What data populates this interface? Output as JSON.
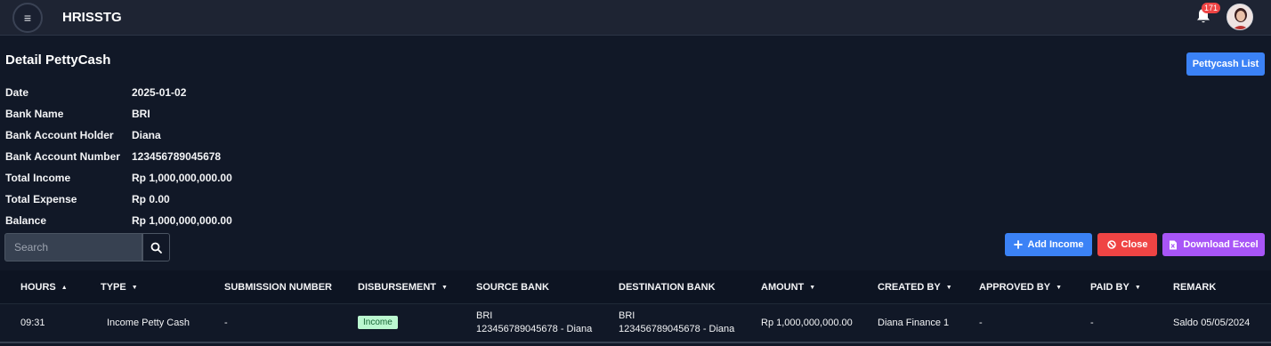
{
  "app": {
    "title": "HRISSTG",
    "menu_icon": "≡",
    "notification_count": "171"
  },
  "page": {
    "title": "Detail PettyCash",
    "list_button": "Pettycash List"
  },
  "info": [
    {
      "label": "Date",
      "value": "2025-01-02"
    },
    {
      "label": "Bank Name",
      "value": "BRI"
    },
    {
      "label": "Bank Account Holder",
      "value": "Diana"
    },
    {
      "label": "Bank Account Number",
      "value": "123456789045678"
    },
    {
      "label": "Total Income",
      "value": "Rp 1,000,000,000.00"
    },
    {
      "label": "Total Expense",
      "value": "Rp 0.00"
    },
    {
      "label": "Balance",
      "value": "Rp 1,000,000,000.00"
    }
  ],
  "search": {
    "placeholder": "Search"
  },
  "actions": {
    "add_income": "Add Income",
    "close": "Close",
    "download_excel": "Download Excel"
  },
  "table": {
    "headers": {
      "hours": "HOURS",
      "type": "TYPE",
      "submission_number": "SUBMISSION NUMBER",
      "disbursement": "DISBURSEMENT",
      "source_bank": "SOURCE BANK",
      "destination_bank": "DESTINATION BANK",
      "amount": "AMOUNT",
      "created_by": "CREATED BY",
      "approved_by": "APPROVED BY",
      "paid_by": "PAID BY",
      "remark": "REMARK"
    },
    "rows": [
      {
        "hours": "09:31",
        "type": "Income Petty Cash",
        "submission_number": "-",
        "disbursement": "Income",
        "source_bank_name": "BRI",
        "source_bank_account": "123456789045678 - Diana",
        "destination_bank_name": "BRI",
        "destination_bank_account": "123456789045678 - Diana",
        "amount": "Rp 1,000,000,000.00",
        "created_by": "Diana Finance 1",
        "approved_by": "-",
        "paid_by": "-",
        "remark": "Saldo 05/05/2024"
      }
    ]
  },
  "colors": {
    "primary": "#3b82f6",
    "danger": "#ef4444",
    "purple": "#a855f7",
    "income_badge": "#bbf7d0"
  }
}
